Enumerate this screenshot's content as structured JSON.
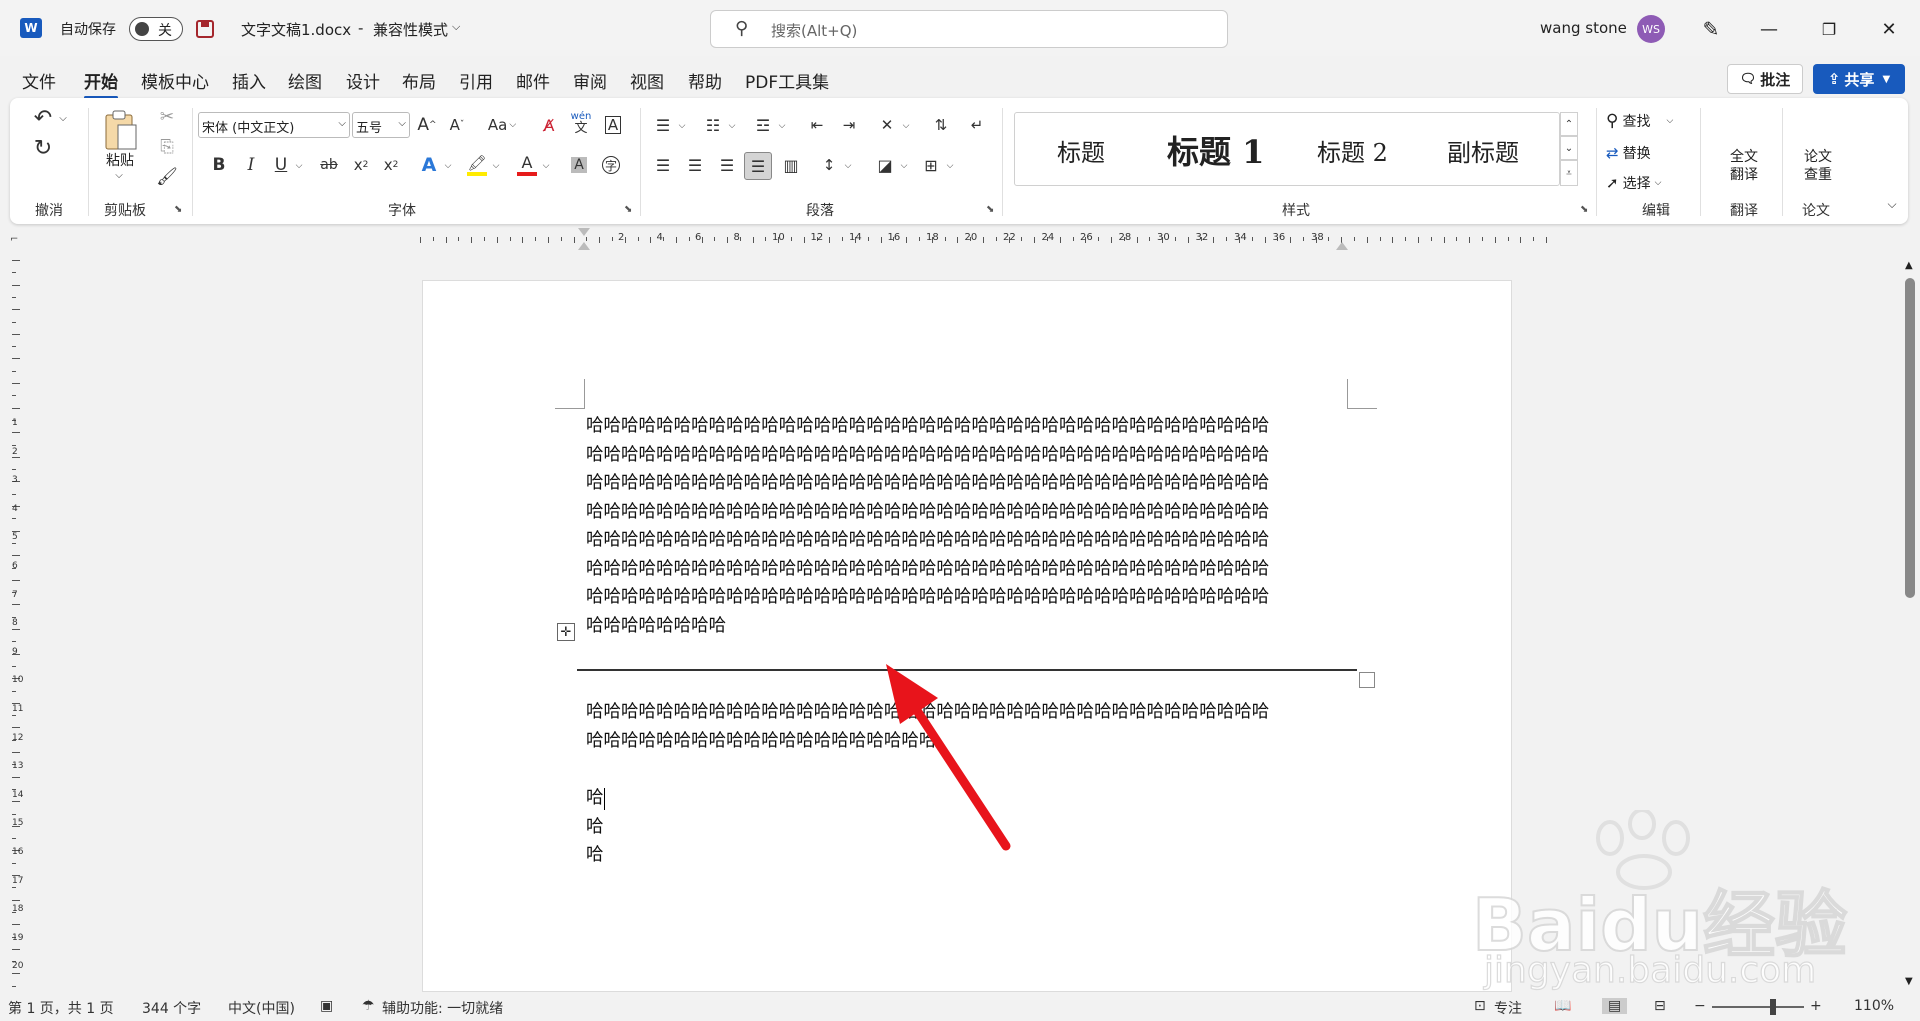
{
  "titlebar": {
    "autosave_label": "自动保存",
    "autosave_state": "关",
    "doc_title": "文字文稿1.docx",
    "separator": "-",
    "mode": "兼容性模式",
    "search_placeholder": "搜索(Alt+Q)",
    "user_name": "wang stone",
    "avatar_initials": "WS"
  },
  "tabs": [
    "文件",
    "开始",
    "模板中心",
    "插入",
    "绘图",
    "设计",
    "布局",
    "引用",
    "邮件",
    "审阅",
    "视图",
    "帮助",
    "PDF工具集"
  ],
  "actions": {
    "comment": "批注",
    "share": "共享"
  },
  "ribbon": {
    "groups": {
      "undo": "撤消",
      "clipboard": "剪贴板",
      "font": "字体",
      "paragraph": "段落",
      "styles": "样式",
      "editing": "编辑",
      "translate": "翻译",
      "paper": "论文"
    },
    "paste": "粘贴",
    "font_name": "宋体 (中文正文)",
    "font_size": "五号",
    "font_btns": {
      "grow": "A",
      "shrink": "A",
      "case": "Aa",
      "bold": "B",
      "italic": "I",
      "underline": "U",
      "strike": "ab",
      "sub": "x",
      "sup": "x",
      "text_effect": "A",
      "font_color": "A",
      "char_shade": "A",
      "phonetic": "wén",
      "phonetic2": "文",
      "border": "A",
      "enclose": "字"
    },
    "styles": [
      "标题",
      "标题 1",
      "标题 2",
      "副标题"
    ],
    "find": "查找",
    "replace": "替换",
    "select": "选择",
    "full_translate_1": "全文",
    "full_translate_2": "翻译",
    "paper_check_1": "论文",
    "paper_check_2": "查重"
  },
  "ruler": {
    "ticks": [
      "2",
      "4",
      "6",
      "8",
      "10",
      "12",
      "14",
      "16",
      "18",
      "20",
      "22",
      "24",
      "26",
      "28",
      "30",
      "32",
      "34",
      "36",
      "38"
    ],
    "vticks": [
      "1",
      "2",
      "3",
      "4",
      "5",
      "6",
      "7",
      "8",
      "9",
      "10",
      "11",
      "12",
      "13",
      "14",
      "15",
      "16",
      "17",
      "18",
      "19",
      "20"
    ]
  },
  "document": {
    "para1": [
      "哈哈哈哈哈哈哈哈哈哈哈哈哈哈哈哈哈哈哈哈哈哈哈哈哈哈哈哈哈哈哈哈哈哈哈哈哈哈哈",
      "哈哈哈哈哈哈哈哈哈哈哈哈哈哈哈哈哈哈哈哈哈哈哈哈哈哈哈哈哈哈哈哈哈哈哈哈哈哈哈",
      "哈哈哈哈哈哈哈哈哈哈哈哈哈哈哈哈哈哈哈哈哈哈哈哈哈哈哈哈哈哈哈哈哈哈哈哈哈哈哈",
      "哈哈哈哈哈哈哈哈哈哈哈哈哈哈哈哈哈哈哈哈哈哈哈哈哈哈哈哈哈哈哈哈哈哈哈哈哈哈哈",
      "哈哈哈哈哈哈哈哈哈哈哈哈哈哈哈哈哈哈哈哈哈哈哈哈哈哈哈哈哈哈哈哈哈哈哈哈哈哈哈",
      "哈哈哈哈哈哈哈哈哈哈哈哈哈哈哈哈哈哈哈哈哈哈哈哈哈哈哈哈哈哈哈哈哈哈哈哈哈哈哈",
      "哈哈哈哈哈哈哈哈哈哈哈哈哈哈哈哈哈哈哈哈哈哈哈哈哈哈哈哈哈哈哈哈哈哈哈哈哈哈哈",
      "哈哈哈哈哈哈哈哈"
    ],
    "para2": [
      "哈哈哈哈哈哈哈哈哈哈哈哈哈哈哈哈哈哈哈哈哈哈哈哈哈哈哈哈哈哈哈哈哈哈哈哈哈哈哈",
      "哈哈哈哈哈哈哈哈哈哈哈哈哈哈哈哈哈哈哈哈"
    ],
    "lines": [
      "哈",
      "哈",
      "哈"
    ]
  },
  "status": {
    "page": "第 1 页，共 1 页",
    "words": "344 个字",
    "lang": "中文(中国)",
    "accessibility": "辅助功能: 一切就绪",
    "focus": "专注",
    "zoom": "110%"
  },
  "watermark": {
    "brand": "Baidu经验",
    "url": "jingyan.baidu.com"
  },
  "colors": {
    "accent": "#185abd",
    "annotation_arrow": "#e8141b",
    "avatar": "#8e5bb5"
  }
}
